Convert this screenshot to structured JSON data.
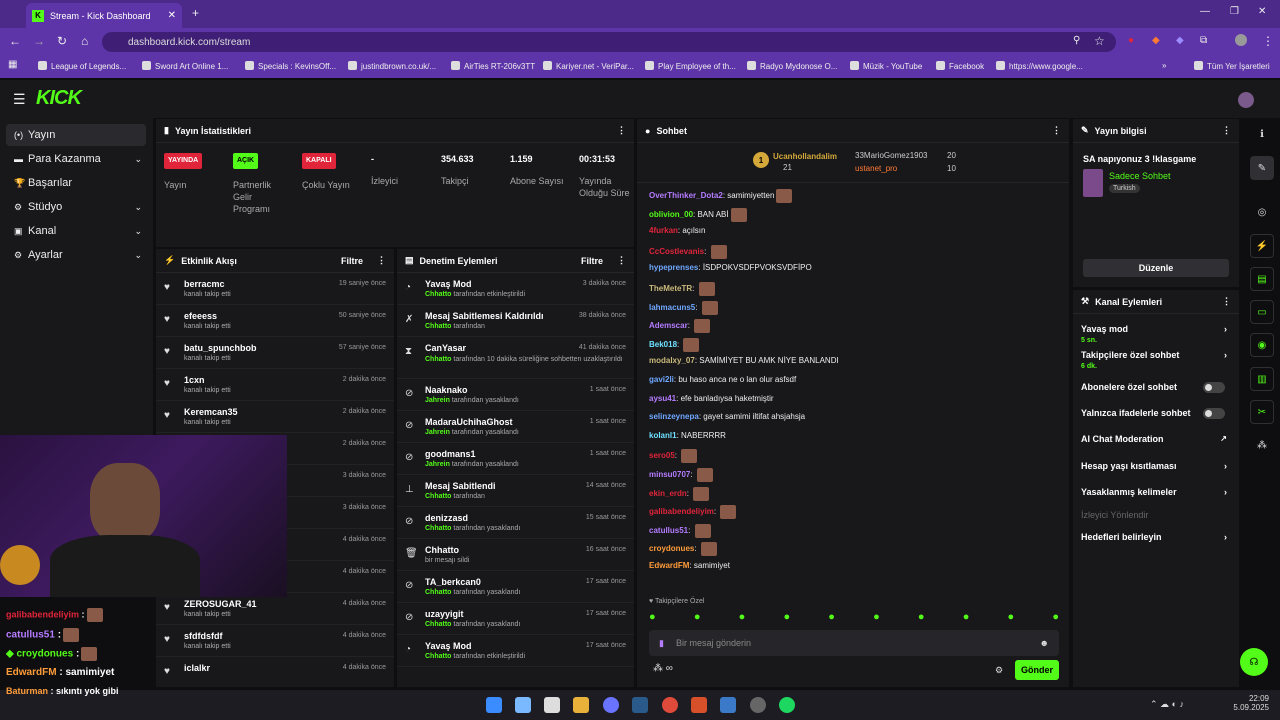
{
  "browser": {
    "tab_title": "Stream - Kick Dashboard",
    "url": "dashboard.kick.com/stream",
    "bookmarks": [
      "League of Legends...",
      "Sword Art Online 1...",
      "Specials : KevinsOff...",
      "justindbrown.co.uk/...",
      "AirTies RT-206v3TT",
      "Kariyer.net - VeriPar...",
      "Play Employee of th...",
      "Radyo Mydonose O...",
      "Müzik - YouTube",
      "Facebook",
      "https://www.google..."
    ],
    "all_bookmarks": "Tüm Yer İşaretleri"
  },
  "app": {
    "logo": "KICK",
    "accent": "#53fc18"
  },
  "sidebar": {
    "items": [
      {
        "label": "Yayın"
      },
      {
        "label": "Para Kazanma"
      },
      {
        "label": "Başarılar"
      },
      {
        "label": "Stüdyo"
      },
      {
        "label": "Kanal"
      },
      {
        "label": "Ayarlar"
      }
    ]
  },
  "stats": {
    "title": "Yayın İstatistikleri",
    "items": [
      {
        "value": "YAYINDA",
        "label": "Yayın",
        "color": "#e0243a"
      },
      {
        "value": "AÇIK",
        "label": "Partnerlik Gelir Programı",
        "color": "#53fc18"
      },
      {
        "value": "KAPALI",
        "label": "Çoklu Yayın",
        "color": "#e0243a"
      },
      {
        "value": "-",
        "label": "İzleyici"
      },
      {
        "value": "354.633",
        "label": "Takipçi"
      },
      {
        "value": "1.159",
        "label": "Abone Sayısı"
      },
      {
        "value": "00:31:53",
        "label": "Yayında Olduğu Süre"
      }
    ]
  },
  "activity": {
    "title": "Etkinlik Akışı",
    "filter": "Filtre",
    "rows": [
      {
        "name": "berracmc",
        "sub": "kanalı takip etti",
        "time": "19 saniye önce"
      },
      {
        "name": "efeeess",
        "sub": "kanalı takip etti",
        "time": "50 saniye önce"
      },
      {
        "name": "batu_spunchbob",
        "sub": "kanalı takip etti",
        "time": "57 saniye önce"
      },
      {
        "name": "1cxn",
        "sub": "kanalı takip etti",
        "time": "2 dakika önce"
      },
      {
        "name": "Keremcan35",
        "sub": "kanalı takip etti",
        "time": "2 dakika önce"
      },
      {
        "name": "",
        "sub": "",
        "time": "2 dakika önce"
      },
      {
        "name": "",
        "sub": "",
        "time": "3 dakika önce"
      },
      {
        "name": "",
        "sub": "",
        "time": "3 dakika önce"
      },
      {
        "name": "",
        "sub": "",
        "time": "4 dakika önce"
      },
      {
        "name": "",
        "sub": "",
        "time": "4 dakika önce"
      },
      {
        "name": "ZEROSUGAR_41",
        "sub": "kanalı takip etti",
        "time": "4 dakika önce"
      },
      {
        "name": "sfdfdsfdf",
        "sub": "kanalı takip etti",
        "time": "4 dakika önce"
      },
      {
        "name": "iclalkr",
        "sub": "",
        "time": "4 dakika önce"
      }
    ]
  },
  "moderation": {
    "title": "Denetim Eylemleri",
    "filter": "Filtre",
    "rows": [
      {
        "name": "Yavaş Mod",
        "by": "Chhatto",
        "sub": "tarafından etkinleştirildi",
        "time": "3 dakika önce"
      },
      {
        "name": "Mesaj Sabitlemesi Kaldırıldı",
        "by": "Chhatto",
        "sub": "tarafından",
        "time": "38 dakika önce"
      },
      {
        "name": "CanYasar",
        "by": "Chhatto",
        "sub": "tarafından 10 dakika süreliğine sohbetten uzaklaştırıldı",
        "time": "41 dakika önce"
      },
      {
        "name": "Naaknako",
        "by": "Jahrein",
        "sub": "tarafından yasaklandı",
        "time": "1 saat önce"
      },
      {
        "name": "MadaraUchihaGhost",
        "by": "Jahrein",
        "sub": "tarafından yasaklandı",
        "time": "1 saat önce"
      },
      {
        "name": "goodmans1",
        "by": "Jahrein",
        "sub": "tarafından yasaklandı",
        "time": "1 saat önce"
      },
      {
        "name": "Mesaj Sabitlendi",
        "by": "Chhatto",
        "sub": "tarafından",
        "time": "14 saat önce"
      },
      {
        "name": "denizzasd",
        "by": "Chhatto",
        "sub": "tarafından yasaklandı",
        "time": "15 saat önce"
      },
      {
        "name": "Chhatto",
        "by": "",
        "sub": "bir mesajı sildi",
        "time": "16 saat önce"
      },
      {
        "name": "TA_berkcan0",
        "by": "Chhatto",
        "sub": "tarafından yasaklandı",
        "time": "17 saat önce"
      },
      {
        "name": "uzayyigit",
        "by": "Chhatto",
        "sub": "tarafından yasaklandı",
        "time": "17 saat önce"
      },
      {
        "name": "Yavaş Mod",
        "by": "Chhatto",
        "sub": "tarafından etkinleştirildi",
        "time": "17 saat önce"
      }
    ]
  },
  "chat": {
    "title": "Sohbet",
    "top_gifters": [
      {
        "name": "Ucanhollandalim",
        "count": "21"
      },
      {
        "name": "33MarioGomez1903",
        "count": "20"
      },
      {
        "name": "ustanet_pro",
        "count": "10"
      }
    ],
    "messages": [
      {
        "user": "OverThinker_Dota2",
        "color": "#b57cff",
        "text": "samimiyetten"
      },
      {
        "user": "oblivion_00",
        "color": "#53fc18",
        "text": "BAN ABİ"
      },
      {
        "user": "4furkan",
        "color": "#e0243a",
        "text": "açılsın"
      },
      {
        "user": "CcCostlevanis",
        "color": "#e0243a",
        "text": ""
      },
      {
        "user": "hypeprenses",
        "color": "#6fa8ff",
        "text": "İSDPOKVSDFPVOKSVDFİPO"
      },
      {
        "user": "TheMeteTR",
        "color": "#c9b97a",
        "text": ""
      },
      {
        "user": "lahmacuns5",
        "color": "#6fa8ff",
        "text": ""
      },
      {
        "user": "Ademscar",
        "color": "#b57cff",
        "text": ""
      },
      {
        "user": "Bek018",
        "color": "#6fe0ff",
        "text": ""
      },
      {
        "user": "modalxy_07",
        "color": "#c9b97a",
        "text": "SAMİMİYET BU AMK NİYE BANLANDI"
      },
      {
        "user": "gavi2li",
        "color": "#6fa8ff",
        "text": "bu haso anca ne o lan olur asfsdf"
      },
      {
        "user": "aysu41",
        "color": "#b57cff",
        "text": "efe banladıysa haketmiştir"
      },
      {
        "user": "selinzeynepa",
        "color": "#6fa8ff",
        "text": "gayet samimi iltifat ahsjahsja"
      },
      {
        "user": "kolanl1",
        "color": "#6fe0ff",
        "text": "NABERRRR"
      },
      {
        "user": "sero05",
        "color": "#e0243a",
        "text": ""
      },
      {
        "user": "minsu0707",
        "color": "#b57cff",
        "text": ""
      },
      {
        "user": "ekin_erdn",
        "color": "#e0243a",
        "text": ""
      },
      {
        "user": "galibabendeliyim",
        "color": "#e0243a",
        "text": ""
      },
      {
        "user": "catullus51",
        "color": "#b57cff",
        "text": ""
      },
      {
        "user": "croydonues",
        "color": "#ff9c3a",
        "text": ""
      },
      {
        "user": "EdwardFM",
        "color": "#ff9c3a",
        "text": "samimiyet"
      }
    ],
    "followers_only": "Takipçilere Özel",
    "input_placeholder": "Bir mesaj gönderin",
    "send": "Gönder"
  },
  "stream_info": {
    "title": "Yayın bilgisi",
    "stream_title": "SA napıyonuz 3 !klasgame",
    "category": "Sadece Sohbet",
    "language": "Turkish",
    "edit": "Düzenle"
  },
  "channel_actions": {
    "title": "Kanal Eylemleri",
    "items": [
      {
        "label": "Yavaş mod",
        "sub": "5 sn."
      },
      {
        "label": "Takipçilere özel sohbet",
        "sub": "6 dk."
      },
      {
        "label": "Abonelere özel sohbet",
        "sub": ""
      },
      {
        "label": "Yalnızca ifadelerle sohbet",
        "sub": ""
      },
      {
        "label": "AI Chat Moderation",
        "sub": ""
      },
      {
        "label": "Hesap yaşı kısıtlaması",
        "sub": ""
      },
      {
        "label": "Yasaklanmış kelimeler",
        "sub": ""
      },
      {
        "label": "İzleyici Yönlendir",
        "sub": ""
      },
      {
        "label": "Hedefleri belirleyin",
        "sub": ""
      }
    ]
  },
  "overlay_chat": [
    {
      "user": "galibabendeliyim",
      "text": ":",
      "color": "#e0243a"
    },
    {
      "user": "catullus51",
      "text": ":",
      "color": "#b57cff"
    },
    {
      "user": "croydonues",
      "text": ":",
      "color": "#53fc18"
    },
    {
      "user": "EdwardFM",
      "text": ": samimiyet",
      "color": "#ff9c3a"
    },
    {
      "user": "Baturman",
      "text": ": sıkıntı yok gibi",
      "color": "#ff9c3a"
    }
  ],
  "taskbar": {
    "time": "22:09",
    "date": "5.09.2025"
  }
}
